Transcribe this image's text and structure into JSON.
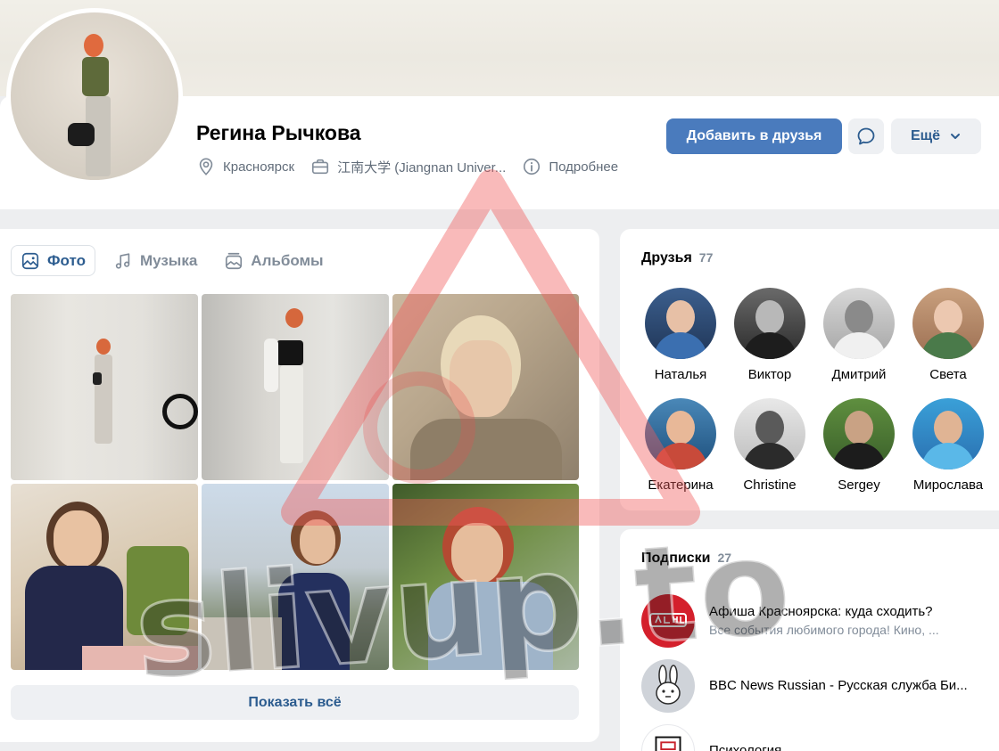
{
  "profile": {
    "name": "Регина Рычкова",
    "city": "Красноярск",
    "education": "江南大学 (Jiangnan Univer...",
    "details_label": "Подробнее",
    "add_friend_label": "Добавить в друзья",
    "more_label": "Ещё"
  },
  "photos": {
    "tabs": [
      {
        "label": "Фото",
        "icon": "photo-icon",
        "active": true
      },
      {
        "label": "Музыка",
        "icon": "music-icon",
        "active": false
      },
      {
        "label": "Альбомы",
        "icon": "albums-icon",
        "active": false
      }
    ],
    "show_all_label": "Показать всё"
  },
  "friends": {
    "title": "Друзья",
    "count": "77",
    "items": [
      {
        "name": "Наталья"
      },
      {
        "name": "Виктор"
      },
      {
        "name": "Дмитрий"
      },
      {
        "name": "Света"
      },
      {
        "name": "Екатерина"
      },
      {
        "name": "Christine"
      },
      {
        "name": "Sergey"
      },
      {
        "name": "Мирослава"
      }
    ]
  },
  "subscriptions": {
    "title": "Подписки",
    "count": "27",
    "items": [
      {
        "title": "Афиша Красноярска: куда сходить?",
        "desc": "Все события любимого города! Кино, ..."
      },
      {
        "title": "BBC News Russian - Русская служба Би...",
        "desc": ""
      },
      {
        "title": "Психология",
        "desc": ""
      }
    ]
  },
  "watermark": {
    "text": "slivup.to"
  },
  "colors": {
    "accent": "#4a7bbd",
    "link": "#2c5c8f",
    "muted": "#818c99"
  }
}
